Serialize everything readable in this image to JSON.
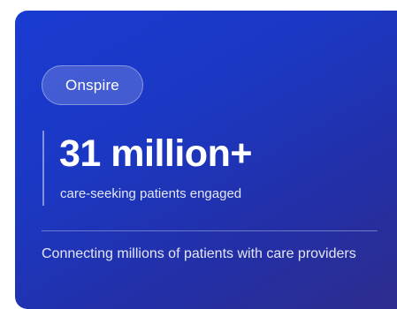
{
  "card": {
    "badge": "Onspire",
    "stat": {
      "value": "31 million+",
      "caption": "care-seeking patients engaged"
    },
    "description": "Connecting millions of patients with care providers",
    "colors": {
      "gradient_start": "#1a3bd2",
      "gradient_end": "#2e2c8c",
      "text": "#ffffff"
    }
  }
}
